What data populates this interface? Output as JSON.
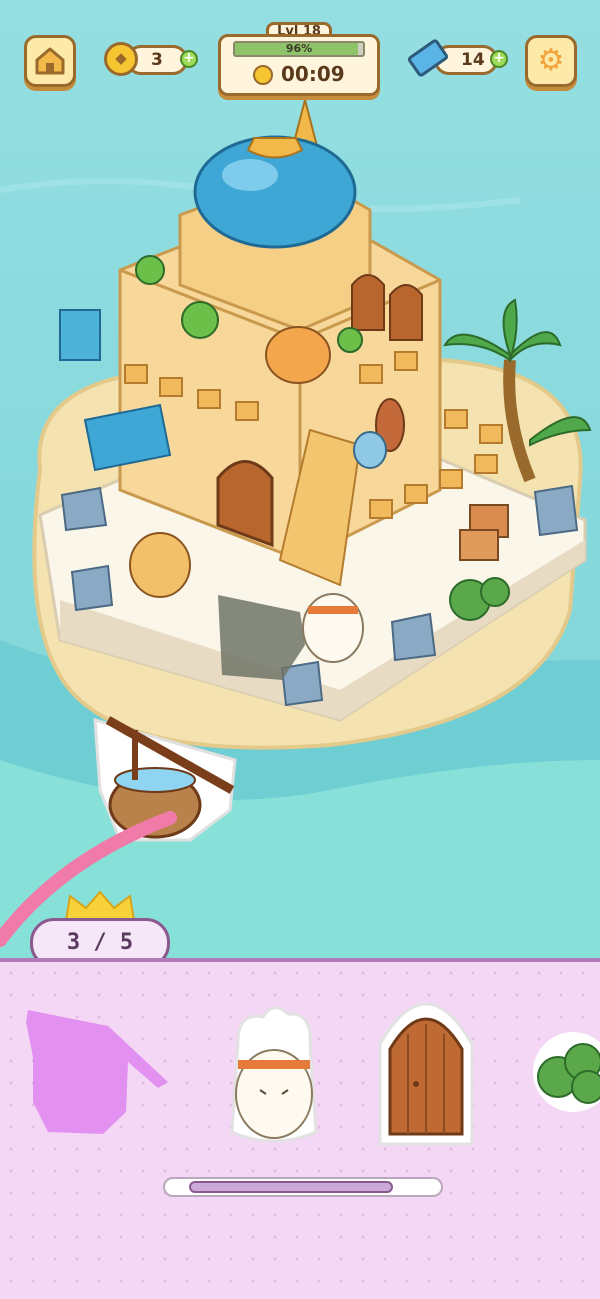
{
  "hud": {
    "coins": "3",
    "level_label": "Lvl 18",
    "progress_text": "96%",
    "progress_fraction": 0.96,
    "timer": "00:09",
    "tickets": "14"
  },
  "counter": {
    "text": "3 / 5"
  },
  "tray": {
    "items": [
      "shadow-well",
      "bunny-character",
      "wooden-door",
      "cactus-bush"
    ],
    "scroll_fraction": 0.74
  },
  "colors": {
    "sea": "#86d8dc",
    "sand": "#f4e3b0",
    "tray": "#f3d7f5",
    "accent": "#b07ab6"
  }
}
